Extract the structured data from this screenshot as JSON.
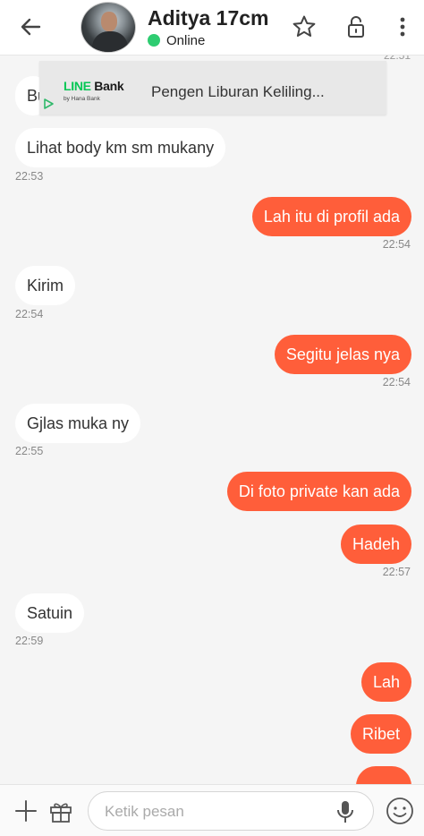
{
  "header": {
    "contact_name": "Aditya 17cm",
    "status": "Online",
    "status_color": "#2ecc71"
  },
  "ad": {
    "brand_name": "LINE Bank",
    "brand_sub": "by Hana Bank",
    "text": "Pengen Liburan Keliling...",
    "partial_time": "22:51"
  },
  "messages": [
    {
      "dir": "in",
      "text": "Bu",
      "time": ""
    },
    {
      "dir": "in",
      "text": "Lihat body km sm mukany",
      "time": "22:53"
    },
    {
      "dir": "out",
      "text": "Lah itu di profil ada",
      "time": "22:54"
    },
    {
      "dir": "in",
      "text": "Kirim",
      "time": "22:54"
    },
    {
      "dir": "out",
      "text": "Segitu jelas nya",
      "time": "22:54"
    },
    {
      "dir": "in",
      "text": "Gjlas muka ny",
      "time": "22:55"
    },
    {
      "dir": "out",
      "text": "Di foto private kan ada",
      "time": ""
    },
    {
      "dir": "out",
      "text": "Hadeh",
      "time": "22:57"
    },
    {
      "dir": "in",
      "text": "Satuin",
      "time": "22:59"
    },
    {
      "dir": "out",
      "text": "Lah",
      "time": ""
    },
    {
      "dir": "out",
      "text": "Ribet",
      "time": ""
    },
    {
      "dir": "out",
      "text": "",
      "time": ""
    }
  ],
  "composer": {
    "placeholder": "Ketik pesan"
  },
  "colors": {
    "outgoing_bubble": "#ff5e3a",
    "incoming_bubble": "#ffffff",
    "background": "#f5f5f5"
  },
  "icons": {
    "back": "arrow-left-icon",
    "favorite": "star-icon",
    "lock": "unlock-icon",
    "menu": "more-vertical-icon",
    "attach": "plus-icon",
    "gift": "gift-icon",
    "voice": "microphone-icon",
    "emoji": "smiley-icon"
  }
}
